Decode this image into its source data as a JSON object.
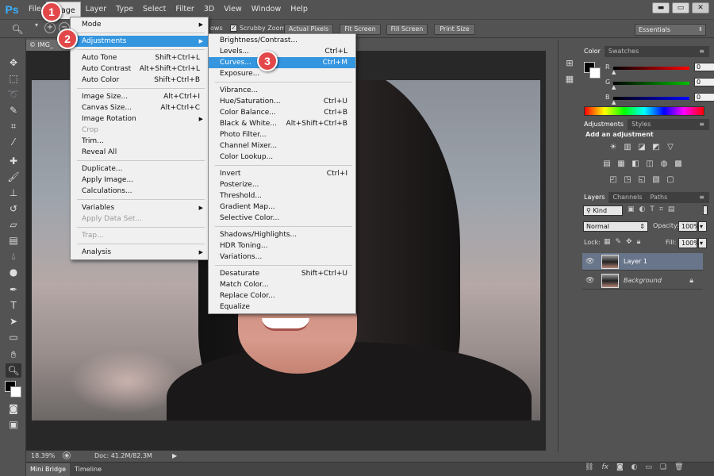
{
  "app": {
    "logo": "Ps"
  },
  "menubar": {
    "items": [
      "File",
      "Image",
      "Layer",
      "Type",
      "Select",
      "Filter",
      "3D",
      "View",
      "Window",
      "Help"
    ],
    "active": "Image"
  },
  "window_controls": {
    "minimize": "▬",
    "restore": "▭",
    "close": "✕"
  },
  "options_bar": {
    "scrubby_label": "Scrubby Zoom",
    "scrubby_checked": true,
    "partial_label": "ows",
    "buttons": [
      "Actual Pixels",
      "Fit Screen",
      "Fill Screen",
      "Print Size"
    ],
    "workspace": "Essentials"
  },
  "document": {
    "tab_label": "© IMG_",
    "zoom": "18.39%",
    "doc_size": "Doc: 41.2M/82.3M"
  },
  "bottom_tabs": [
    "Mini Bridge",
    "Timeline"
  ],
  "image_menu": [
    {
      "label": "Mode",
      "submenu": true
    },
    {
      "sep": true
    },
    {
      "label": "Adjustments",
      "submenu": true,
      "highlight": true
    },
    {
      "sep": true
    },
    {
      "label": "Auto Tone",
      "shortcut": "Shift+Ctrl+L"
    },
    {
      "label": "Auto Contrast",
      "shortcut": "Alt+Shift+Ctrl+L"
    },
    {
      "label": "Auto Color",
      "shortcut": "Shift+Ctrl+B"
    },
    {
      "sep": true
    },
    {
      "label": "Image Size...",
      "shortcut": "Alt+Ctrl+I"
    },
    {
      "label": "Canvas Size...",
      "shortcut": "Alt+Ctrl+C"
    },
    {
      "label": "Image Rotation",
      "submenu": true
    },
    {
      "label": "Crop",
      "disabled": true
    },
    {
      "label": "Trim..."
    },
    {
      "label": "Reveal All"
    },
    {
      "sep": true
    },
    {
      "label": "Duplicate..."
    },
    {
      "label": "Apply Image..."
    },
    {
      "label": "Calculations..."
    },
    {
      "sep": true
    },
    {
      "label": "Variables",
      "submenu": true
    },
    {
      "label": "Apply Data Set...",
      "disabled": true
    },
    {
      "sep": true
    },
    {
      "label": "Trap...",
      "disabled": true
    },
    {
      "sep": true
    },
    {
      "label": "Analysis",
      "submenu": true
    }
  ],
  "adjustments_menu": [
    {
      "label": "Brightness/Contrast..."
    },
    {
      "label": "Levels...",
      "shortcut": "Ctrl+L"
    },
    {
      "label": "Curves...",
      "shortcut": "Ctrl+M",
      "highlight": true
    },
    {
      "label": "Exposure..."
    },
    {
      "sep": true
    },
    {
      "label": "Vibrance..."
    },
    {
      "label": "Hue/Saturation...",
      "shortcut": "Ctrl+U"
    },
    {
      "label": "Color Balance...",
      "shortcut": "Ctrl+B"
    },
    {
      "label": "Black & White...",
      "shortcut": "Alt+Shift+Ctrl+B"
    },
    {
      "label": "Photo Filter..."
    },
    {
      "label": "Channel Mixer..."
    },
    {
      "label": "Color Lookup..."
    },
    {
      "sep": true
    },
    {
      "label": "Invert",
      "shortcut": "Ctrl+I"
    },
    {
      "label": "Posterize..."
    },
    {
      "label": "Threshold..."
    },
    {
      "label": "Gradient Map..."
    },
    {
      "label": "Selective Color..."
    },
    {
      "sep": true
    },
    {
      "label": "Shadows/Highlights..."
    },
    {
      "label": "HDR Toning..."
    },
    {
      "label": "Variations..."
    },
    {
      "sep": true
    },
    {
      "label": "Desaturate",
      "shortcut": "Shift+Ctrl+U"
    },
    {
      "label": "Match Color..."
    },
    {
      "label": "Replace Color..."
    },
    {
      "label": "Equalize"
    }
  ],
  "callouts": [
    "1",
    "2",
    "3"
  ],
  "color_panel": {
    "tabs": [
      "Color",
      "Swatches"
    ],
    "channels": [
      {
        "label": "R",
        "value": "0",
        "color": "#ff0000"
      },
      {
        "label": "G",
        "value": "0",
        "color": "#00c000"
      },
      {
        "label": "B",
        "value": "0",
        "color": "#0000ff"
      }
    ]
  },
  "adjustments_panel": {
    "tabs": [
      "Adjustments",
      "Styles"
    ],
    "heading": "Add an adjustment"
  },
  "layers_panel": {
    "tabs": [
      "Layers",
      "Channels",
      "Paths"
    ],
    "filter": "Kind",
    "blend_mode": "Normal",
    "opacity_label": "Opacity:",
    "opacity": "100%",
    "lock_label": "Lock:",
    "fill_label": "Fill:",
    "fill": "100%",
    "layers": [
      {
        "name": "Layer 1",
        "selected": true,
        "locked": false
      },
      {
        "name": "Background",
        "selected": false,
        "locked": true
      }
    ]
  },
  "colors": {
    "accent": "#3596e0",
    "callout": "#e2484a",
    "selected_layer": "#68758a"
  }
}
